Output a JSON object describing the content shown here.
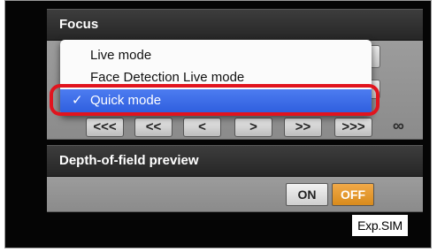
{
  "focus": {
    "title": "Focus",
    "mode_menu": {
      "items": [
        {
          "label": "Live mode",
          "selected": false
        },
        {
          "label": "Face Detection Live mode",
          "selected": false
        },
        {
          "label": "Quick mode",
          "selected": true
        }
      ],
      "checkmark": "✓"
    },
    "drive_buttons": [
      "<<<",
      "<<",
      "<",
      ">",
      ">>",
      ">>>"
    ],
    "infinity_symbol": "∞"
  },
  "depth_of_field": {
    "title": "Depth-of-field preview",
    "on_label": "ON",
    "off_label": "OFF",
    "active": "OFF",
    "active_color": "#e59a2c"
  },
  "exposure_badge": "Exp.SIM",
  "highlight_color": "#e1141e"
}
